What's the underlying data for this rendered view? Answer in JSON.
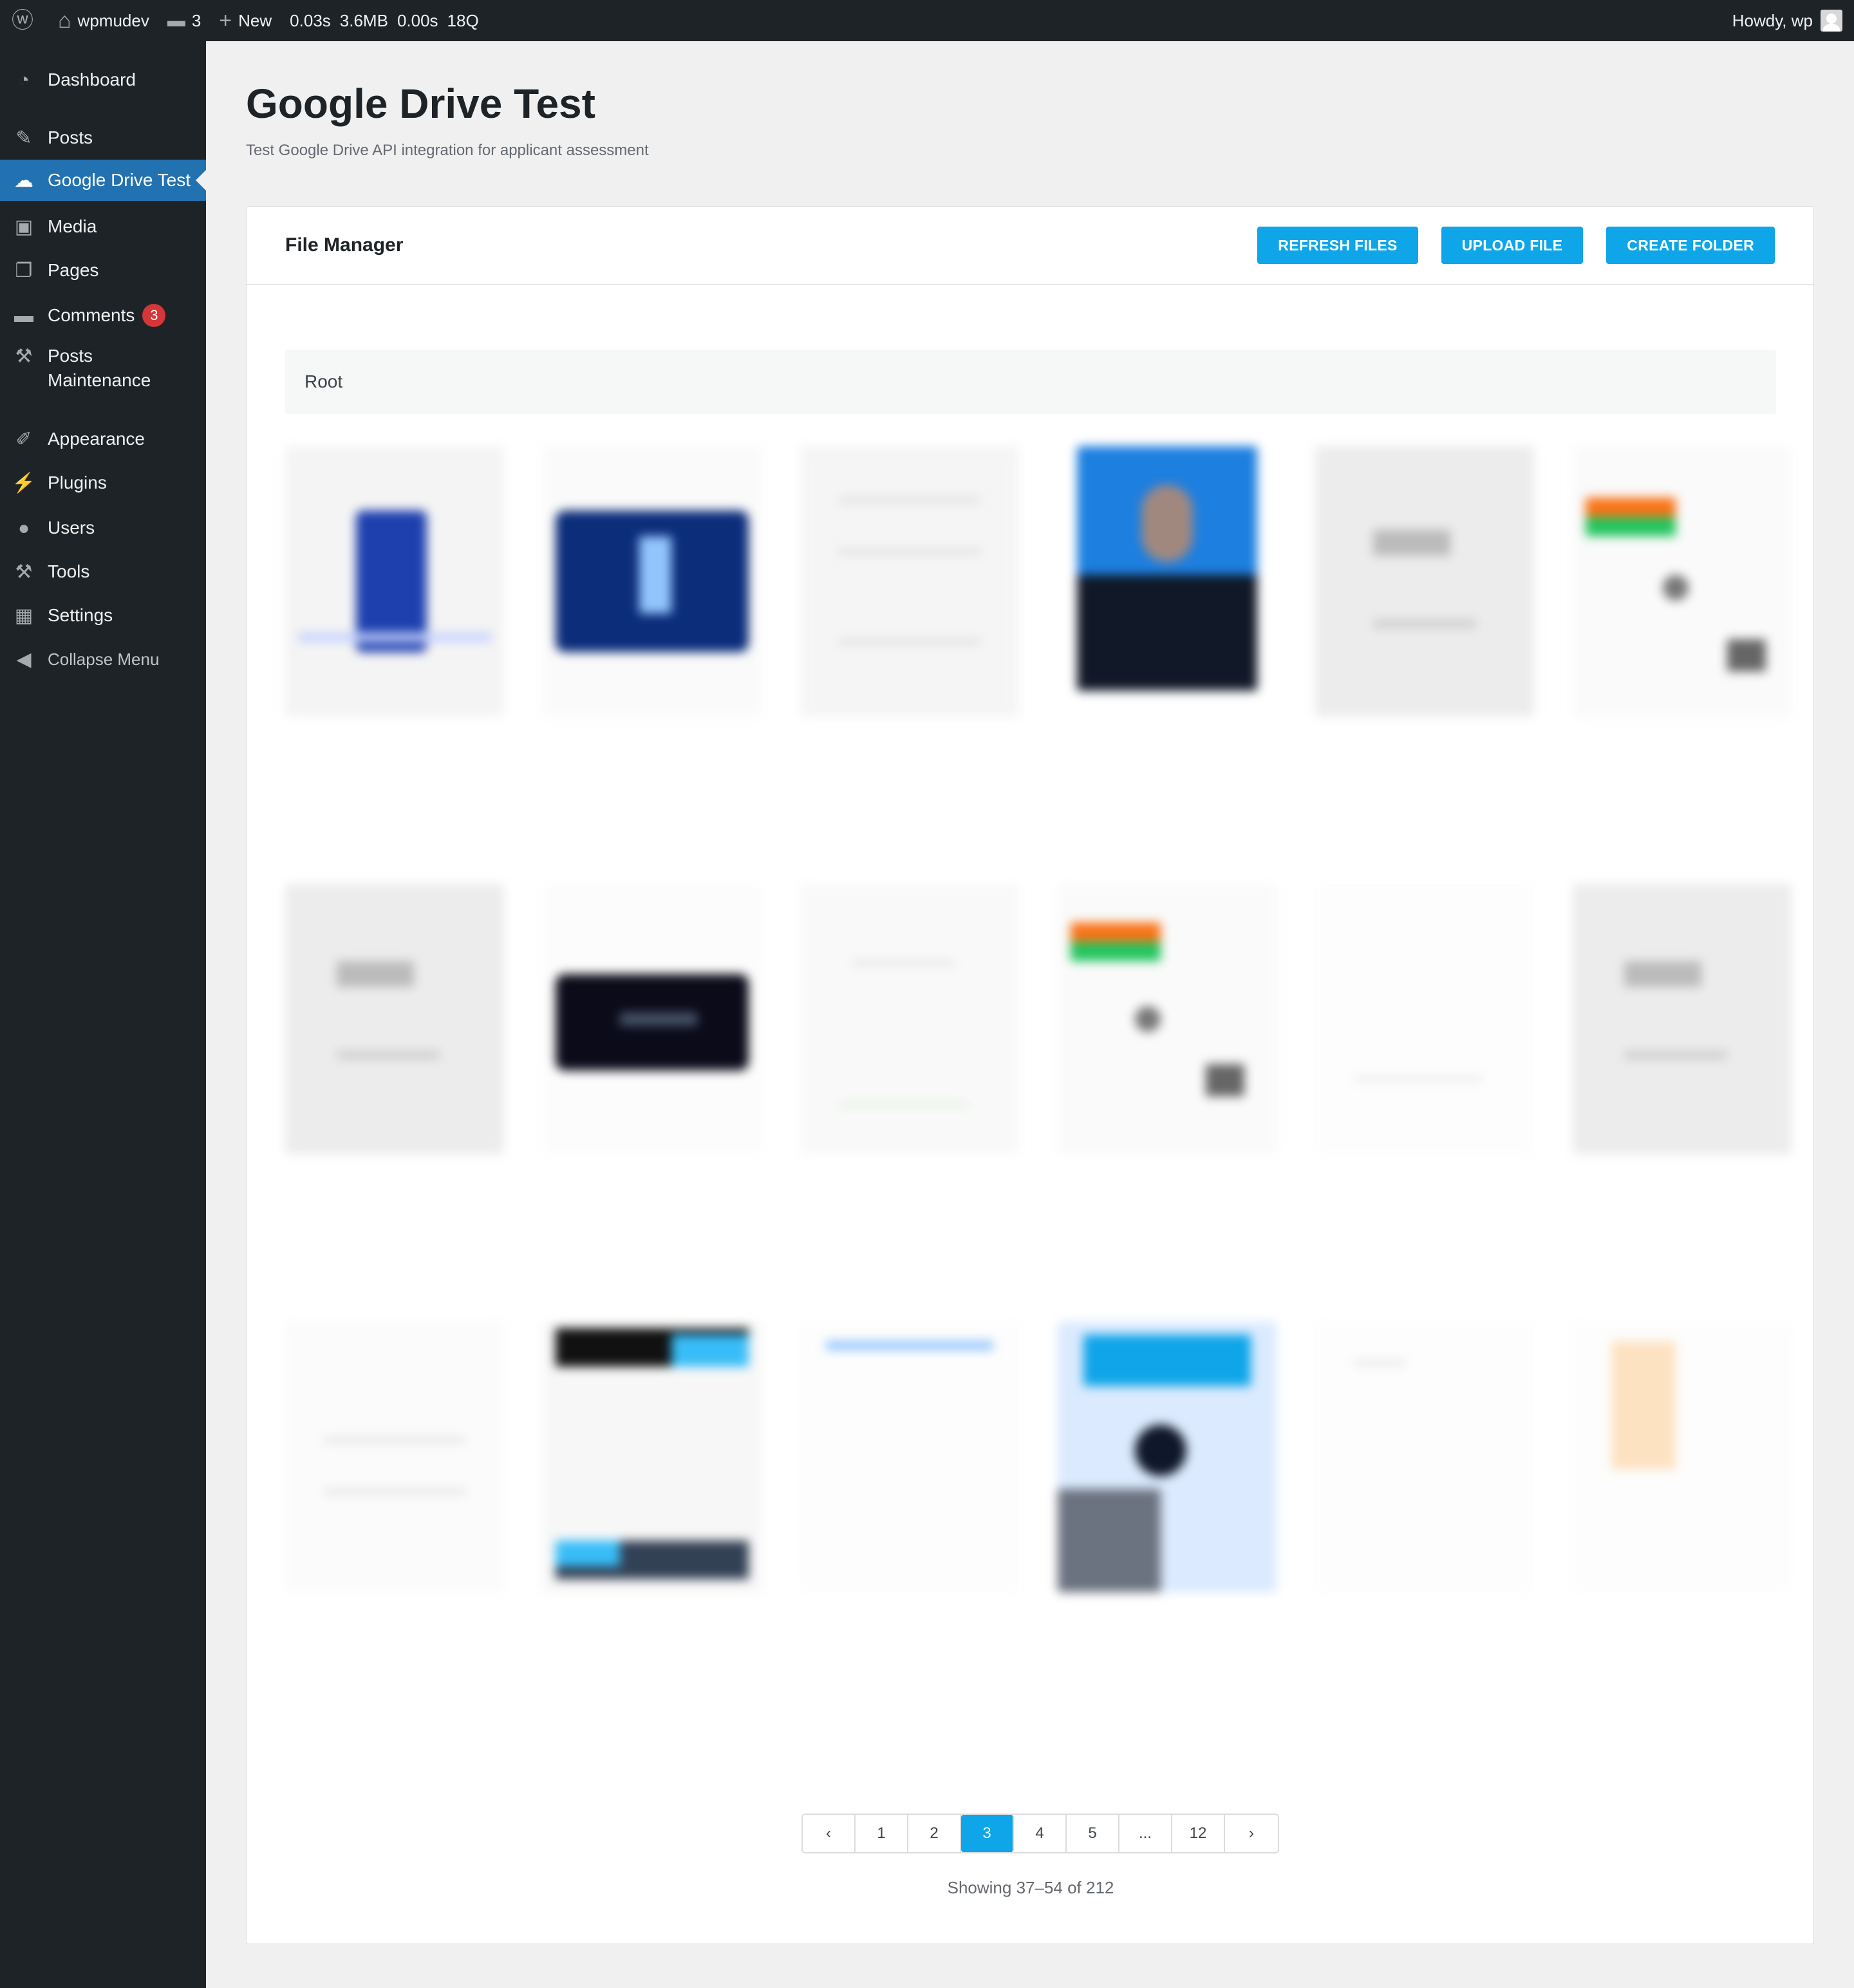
{
  "adminbar": {
    "site_name": "wpmudev",
    "comments_count": "3",
    "new_label": "New",
    "stats": [
      "0.03s",
      "3.6MB",
      "0.00s",
      "18Q"
    ],
    "howdy": "Howdy, wp"
  },
  "sidebar": {
    "items": [
      {
        "label": "Dashboard",
        "icon": "dashboard-icon",
        "glyph": "◔"
      },
      {
        "label": "Posts",
        "icon": "pushpin-icon",
        "glyph": "✎"
      },
      {
        "label": "Google Drive Test",
        "icon": "cloud-icon",
        "glyph": "☁"
      },
      {
        "label": "Media",
        "icon": "media-icon",
        "glyph": "▣"
      },
      {
        "label": "Pages",
        "icon": "pages-icon",
        "glyph": "❐"
      },
      {
        "label": "Comments",
        "icon": "comment-icon",
        "glyph": "▬",
        "badge": "3"
      },
      {
        "label": "Posts Maintenance",
        "icon": "wrench-icon",
        "glyph": "⚒"
      },
      {
        "label": "Appearance",
        "icon": "brush-icon",
        "glyph": "✐"
      },
      {
        "label": "Plugins",
        "icon": "plugin-icon",
        "glyph": "⚡"
      },
      {
        "label": "Users",
        "icon": "user-icon",
        "glyph": "●"
      },
      {
        "label": "Tools",
        "icon": "tools-icon",
        "glyph": "⚒"
      },
      {
        "label": "Settings",
        "icon": "settings-icon",
        "glyph": "▦"
      }
    ],
    "collapse_label": "Collapse Menu"
  },
  "page": {
    "title": "Google Drive Test",
    "description": "Test Google Drive API integration for applicant assessment"
  },
  "file_manager": {
    "title": "File Manager",
    "buttons": {
      "refresh": "REFRESH FILES",
      "upload": "UPLOAD FILE",
      "create_folder": "CREATE FOLDER"
    },
    "breadcrumb": "Root"
  },
  "pagination": {
    "prev": "‹",
    "next": "›",
    "pages": [
      "1",
      "2",
      "3",
      "4",
      "5",
      "...",
      "12"
    ],
    "current": "3",
    "showing": "Showing 37–54 of 212"
  },
  "colors": {
    "accent": "#0ea5e9",
    "admin_bg": "#1d2327",
    "menu_current": "#2271b1",
    "badge": "#d63638"
  }
}
